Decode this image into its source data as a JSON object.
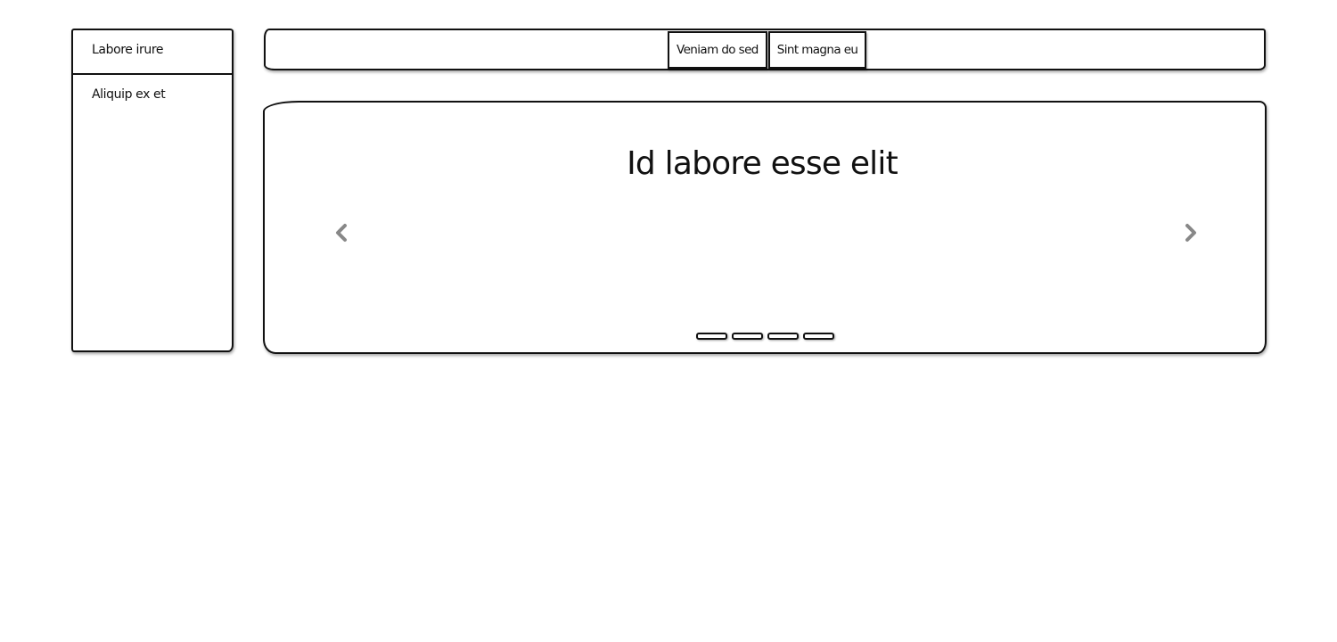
{
  "sidebar": {
    "items": [
      {
        "label": "Labore irure"
      },
      {
        "label": "Aliquip ex et"
      }
    ]
  },
  "topbar": {
    "buttons": [
      {
        "label": "Veniam do sed"
      },
      {
        "label": "Sint magna eu"
      }
    ]
  },
  "carousel": {
    "title": "Id labore esse elit",
    "prev_icon": "chevron-left-icon",
    "next_icon": "chevron-right-icon",
    "slide_count": 4,
    "arrow_color": "#888888"
  }
}
